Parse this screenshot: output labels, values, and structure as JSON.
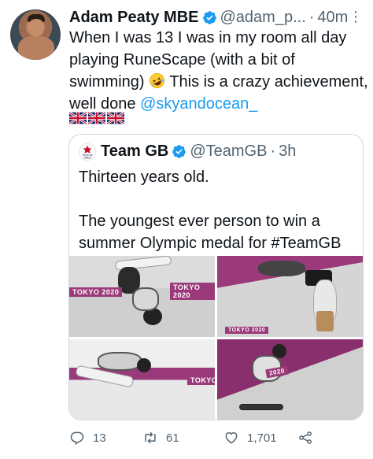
{
  "author": {
    "name": "Adam Peaty MBE",
    "handle": "@adam_p...",
    "separator": "·",
    "time": "40m",
    "verified": true
  },
  "tweet": {
    "text_before": "When I was 13 I was in my room all day playing RuneScape (with a bit of swimming)",
    "text_after": " This is a crazy achievement, well done ",
    "mention": "@skyandocean_",
    "emoji": "rolling-on-the-floor-laughing",
    "flags": [
      "union-jack-flag",
      "union-jack-flag",
      "union-jack-flag"
    ]
  },
  "quote": {
    "name": "Team GB",
    "handle": "@TeamGB",
    "separator": "·",
    "time": "3h",
    "verified": true,
    "line1": "Thirteen years old.",
    "line2": "The youngest ever person to win a summer Olympic medal for #TeamGB",
    "media_banners": [
      "TOKYO 2020",
      "TOKYO 2020",
      "TOKYO 2020",
      "TOKYO",
      "2020"
    ]
  },
  "actions": {
    "reply_count": "13",
    "retweet_count": "61",
    "like_count": "1,701"
  },
  "colors": {
    "accent": "#1d9bf0",
    "muted": "#536471",
    "border": "#cfd9de",
    "tokyo_purple": "#9b3a7a"
  }
}
